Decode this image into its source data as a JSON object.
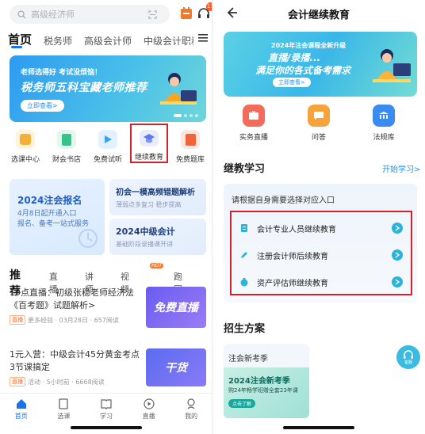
{
  "left": {
    "search": {
      "placeholder": "高级经济师"
    },
    "notif_count": "11",
    "tabs": [
      "首页",
      "税务师",
      "高级会计师",
      "中级会计职称"
    ],
    "banner": {
      "line1": "老师选得好 考试没烦恼！",
      "line2": "税务师五科宝藏老师推荐",
      "button": "立即查看>"
    },
    "grid": [
      {
        "label": "选课中心",
        "color": "#f5b03a"
      },
      {
        "label": "财会书店",
        "color": "#34c48a"
      },
      {
        "label": "免费试听",
        "color": "#3aa0f0"
      },
      {
        "label": "继续教育",
        "color": "#5a7cf0"
      },
      {
        "label": "免费题库",
        "color": "#f0643a"
      }
    ],
    "card_a": {
      "title": "2024注会报名",
      "line1": "4月8日起开通入口",
      "line2": "报名、备考一站式服务"
    },
    "card_b": {
      "title": "初会一模高频错题解析",
      "sub": "薄弱点多复习 稳步提高"
    },
    "card_c": {
      "title": "2024中级会计",
      "sub": "基础阶段录播课开讲"
    },
    "rec_tabs": [
      "推荐",
      "直播",
      "讲师",
      "视频",
      "跑团"
    ],
    "hot_label": "HOT",
    "articles": [
      {
        "title": "19点直播：初级张稳老师经济法《百考题》试题解析>",
        "tag": "直播",
        "meta": "更多经验 · 03月28日 · 657阅读",
        "thumb": "免费直播"
      },
      {
        "title": "1元入营：中级会计45分黄金考点3节课搞定",
        "tag": "直播",
        "meta": "活动 · 5小时前 · 6668阅读",
        "thumb": "干货"
      }
    ],
    "tabbar": [
      "首页",
      "选课",
      "学习",
      "直播",
      "我的"
    ]
  },
  "right": {
    "title": "会计继续教育",
    "banner": {
      "line1": "2024年注会课程全新升级",
      "line2": "直播/录播...",
      "line3": "满足你的各式备考需求",
      "button": "立即查看>"
    },
    "grid": [
      {
        "label": "实务直播",
        "color": "#f26b5b"
      },
      {
        "label": "问答",
        "color": "#f5a33a"
      },
      {
        "label": "法规库",
        "color": "#3a8cf0"
      }
    ],
    "section1": "继教学习",
    "start_link": "开始学习>",
    "prompt": "请根据自身需要选择对应入口",
    "items": [
      "会计专业人员继续教育",
      "注册会计师后续教育",
      "资产评估师继续教育"
    ],
    "section2": "招生方案",
    "plan": {
      "head": "注会新考季",
      "a": "2024注会新考季",
      "b": "购24年畅学班赠全套23年课",
      "c": "点击了解"
    },
    "service": "客服"
  }
}
